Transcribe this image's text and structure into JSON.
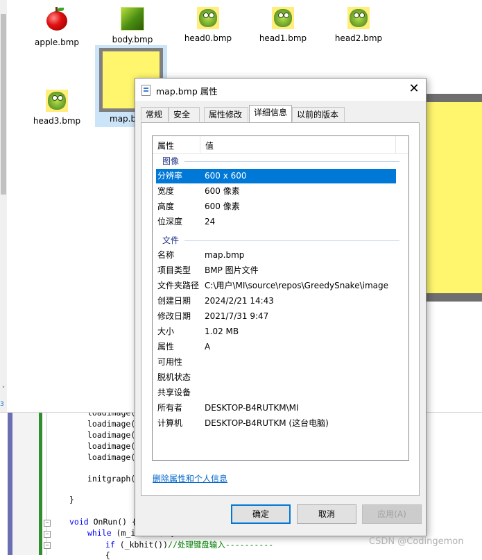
{
  "explorer": {
    "files": [
      {
        "name": "apple.bmp"
      },
      {
        "name": "body.bmp"
      },
      {
        "name": "head0.bmp"
      },
      {
        "name": "head1.bmp"
      },
      {
        "name": "head2.bmp"
      },
      {
        "name": "head3.bmp"
      },
      {
        "name": "map.b"
      }
    ],
    "scroll_down": "˅",
    "side_digit": "3"
  },
  "dialog": {
    "title": "map.bmp 属性",
    "close": "✕",
    "tabs": [
      "常规",
      "安全",
      "属性修改",
      "详细信息",
      "以前的版本"
    ],
    "active_tab": "详细信息",
    "columns": {
      "property": "属性",
      "value": "值"
    },
    "groups": [
      {
        "name": "图像",
        "rows": [
          {
            "key": "分辨率",
            "value": "600 x 600",
            "selected": true
          },
          {
            "key": "宽度",
            "value": "600 像素"
          },
          {
            "key": "高度",
            "value": "600 像素"
          },
          {
            "key": "位深度",
            "value": "24"
          }
        ]
      },
      {
        "name": "文件",
        "rows": [
          {
            "key": "名称",
            "value": "map.bmp"
          },
          {
            "key": "项目类型",
            "value": "BMP 图片文件"
          },
          {
            "key": "文件夹路径",
            "value": "C:\\用户\\MI\\source\\repos\\GreedySnake\\image"
          },
          {
            "key": "创建日期",
            "value": "2024/2/21 14:43"
          },
          {
            "key": "修改日期",
            "value": "2021/7/31 9:47"
          },
          {
            "key": "大小",
            "value": "1.02 MB"
          },
          {
            "key": "属性",
            "value": "A"
          },
          {
            "key": "可用性",
            "value": ""
          },
          {
            "key": "脱机状态",
            "value": ""
          },
          {
            "key": "共享设备",
            "value": ""
          },
          {
            "key": "所有者",
            "value": "DESKTOP-B4RUTKM\\MI"
          },
          {
            "key": "计算机",
            "value": "DESKTOP-B4RUTKM (这台电脑)"
          }
        ]
      }
    ],
    "remove_link": "删除属性和个人信息",
    "buttons": {
      "ok": "确定",
      "cancel": "取消",
      "apply": "应用(A)"
    }
  },
  "code": {
    "loadimage_lines": [
      "loadimage(&",
      "loadimage(&",
      "loadimage(&",
      "loadimage(&",
      "loadimage(&"
    ],
    "initgraph": "initgraph(s",
    "close_brace": "}",
    "onrun": {
      "kw": "void",
      "rest": " OnRun() {"
    },
    "while": {
      "kw": "while",
      "rest": " (m_isQuit) {"
    },
    "if": {
      "kw": "if",
      "rest": " (_kbhit())",
      "comment": "//处理键盘输入----------"
    },
    "brace_line": "{",
    "fold_minus": "−"
  },
  "watermark": "CSDN @Codingemon"
}
